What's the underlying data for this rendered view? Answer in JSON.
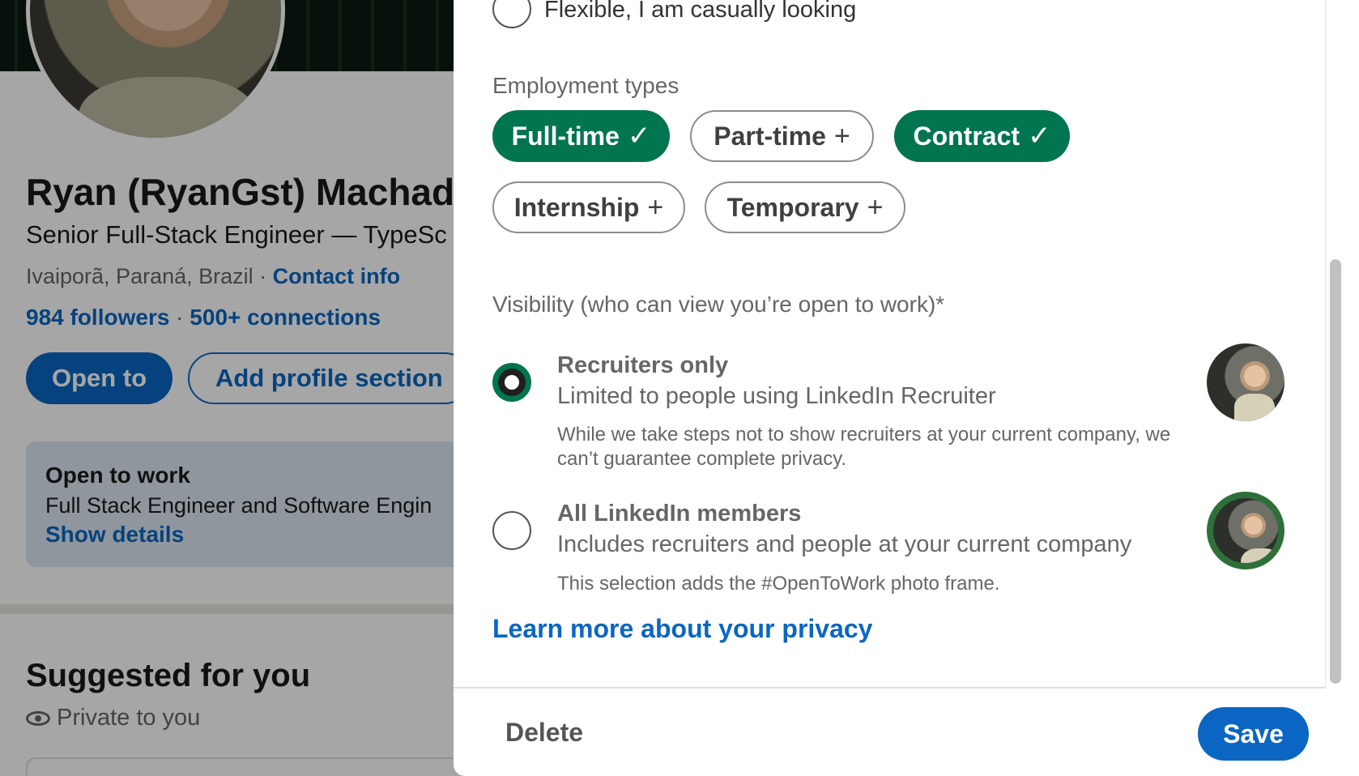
{
  "profile": {
    "name": "Ryan (RyanGst) Machad",
    "headline": "Senior Full-Stack Engineer — TypeSc",
    "location": "Ivaiporã, Paraná, Brazil",
    "location_sep": " · ",
    "contact_link": "Contact info",
    "followers": "984 followers",
    "connections_sep": " · ",
    "connections": "500+ connections",
    "open_to_button": "Open to",
    "add_section_button": "Add profile section",
    "otw_card": {
      "title": "Open to work",
      "description": "Full Stack Engineer and Software Engin",
      "link": "Show details"
    },
    "suggested_title": "Suggested for you",
    "private_label": "Private to you"
  },
  "modal": {
    "flexible_option": "Flexible, I am casually looking",
    "employment_types_label": "Employment types",
    "employment_types": [
      {
        "label": "Full-time",
        "selected": true,
        "icon": "check-icon"
      },
      {
        "label": "Part-time",
        "selected": false,
        "icon": "plus-icon"
      },
      {
        "label": "Contract",
        "selected": true,
        "icon": "check-icon"
      },
      {
        "label": "Internship",
        "selected": false,
        "icon": "plus-icon"
      },
      {
        "label": "Temporary",
        "selected": false,
        "icon": "plus-icon"
      }
    ],
    "visibility_label": "Visibility (who can view you’re open to work)*",
    "visibility_options": [
      {
        "title": "Recruiters only",
        "subtitle": "Limited to people using LinkedIn Recruiter",
        "note": "While we take steps not to show recruiters at your current company, we can’t guarantee complete privacy.",
        "selected": true
      },
      {
        "title": "All LinkedIn members",
        "subtitle": "Includes recruiters and people at your current company",
        "note": "This selection adds the #OpenToWork photo frame.",
        "selected": false
      }
    ],
    "learn_more_link": "Learn more about your privacy",
    "delete_button": "Delete",
    "save_button": "Save"
  },
  "colors": {
    "accent_blue": "#0a66c2",
    "selected_green": "#01754f"
  }
}
